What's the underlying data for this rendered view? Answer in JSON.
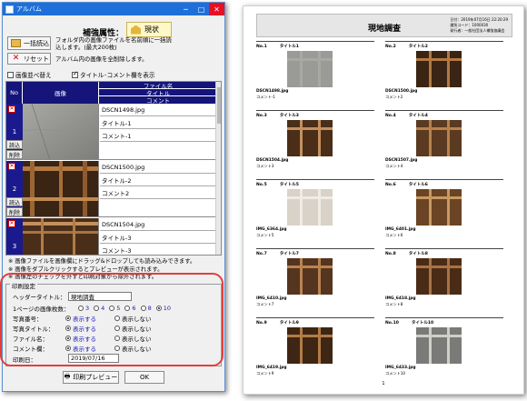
{
  "window": {
    "title": "アルバム",
    "controls": {
      "minimize": "─",
      "maximize": "□",
      "close": "✕"
    }
  },
  "toolbar": {
    "bulk_load_label": "一括読込",
    "reset_label": "リセット",
    "bulk_load_note": "フォルダ内の画像ファイルを名前順に一括読込します。(最大200枚)",
    "reset_note": "アルバム内の画像を全削除します。"
  },
  "property": {
    "label": "補強属性：",
    "value": "現状"
  },
  "options": {
    "sort_images": "画像並べ替え",
    "show_title_comment": "タイトル･コメント欄を表示"
  },
  "grid": {
    "headers": {
      "no": "No",
      "image": "画像",
      "filename": "ファイル名",
      "title": "タイトル",
      "comment": "コメント"
    },
    "row_buttons": {
      "load": "読込",
      "delete": "削除",
      "remove_mark": "✕"
    },
    "rows": [
      {
        "no": "1",
        "filename": "DSCN1498.jpg",
        "title": "タイトル-1",
        "comment": "コメント-1"
      },
      {
        "no": "2",
        "filename": "DSCN1500.jpg",
        "title": "タイトル-2",
        "comment": "コメント2"
      },
      {
        "no": "3",
        "filename": "DSCN1504.jpg",
        "title": "タイトル-3",
        "comment": "コメント-3"
      }
    ]
  },
  "notes": [
    "※ 画像ファイルを画像欄にドラッグ&ドロップしても読み込みできます。",
    "※ 画像をダブルクリックするとプレビューが表示されます。",
    "※ 画像左のチェックを外すと印刷対象から除外されます。"
  ],
  "print_settings": {
    "legend": "印刷設定",
    "header_title_label": "ヘッダータイトル：",
    "header_title_value": "現地調査",
    "per_page_label": "1ページの画像枚数：",
    "per_page_options": [
      "3",
      "4",
      "5",
      "6",
      "8",
      "10"
    ],
    "per_page_selected": "10",
    "photo_number_label": "写真番号：",
    "photo_title_label": "写真タイトル：",
    "filename_label": "ファイル名：",
    "comment_label": "コメント欄：",
    "show": "表示する",
    "hide": "表示しない",
    "print_date_label": "印刷日：",
    "print_date_value": "2019/07/16"
  },
  "buttons": {
    "preview": "印刷プレビュー",
    "ok": "OK"
  },
  "document": {
    "title": "現地調査",
    "meta_lines": [
      "日付：2019年07月16日 22:20:29",
      "識別コード：1000030",
      "発行者：一般社団法人補強協議会"
    ],
    "page_number": "1",
    "items": [
      {
        "no": "No.1",
        "title": "タイトル1",
        "file": "DSCN1498.jpg",
        "comment": "コメント-1"
      },
      {
        "no": "No.2",
        "title": "タイトル2",
        "file": "DSCN1500.jpg",
        "comment": "コメント2"
      },
      {
        "no": "No.3",
        "title": "タイトル3",
        "file": "DSCN1504.jpg",
        "comment": "コメント3"
      },
      {
        "no": "No.4",
        "title": "タイトル4",
        "file": "DSCN1507.jpg",
        "comment": "コメント4"
      },
      {
        "no": "No.5",
        "title": "タイトル5",
        "file": "IMG_6364.jpg",
        "comment": "コメント5"
      },
      {
        "no": "No.6",
        "title": "タイトル6",
        "file": "IMG_6401.jpg",
        "comment": "コメント6"
      },
      {
        "no": "No.7",
        "title": "タイトル7",
        "file": "IMG_6410.jpg",
        "comment": "コメント7"
      },
      {
        "no": "No.8",
        "title": "タイトル8",
        "file": "IMG_6418.jpg",
        "comment": "コメント8"
      },
      {
        "no": "No.9",
        "title": "タイトル9",
        "file": "IMG_6419.jpg",
        "comment": "コメント9"
      },
      {
        "no": "No.10",
        "title": "タイトル10",
        "file": "IMG_6433.jpg",
        "comment": "コメント10"
      }
    ]
  },
  "colors": {
    "title_bar": "#1e6fd9",
    "grid_header": "#14147a",
    "row_number": "#1a1a8e",
    "highlight_oval": "#e0403a",
    "radio_label": "#1a1ab8"
  }
}
